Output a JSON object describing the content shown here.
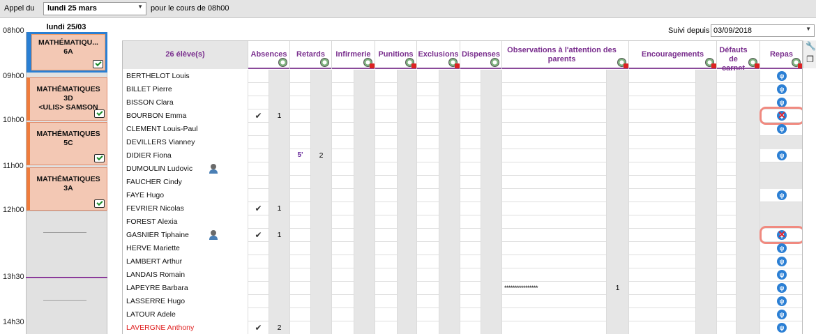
{
  "topbar": {
    "appel_label": "Appel du",
    "date_value": "lundi 25 mars",
    "course_label": "pour le cours de 08h00"
  },
  "timeline": {
    "day_label": "lundi 25/03",
    "hours": [
      "08h00",
      "09h00",
      "10h00",
      "11h00",
      "12h00",
      "13h30",
      "14h30"
    ],
    "courses": [
      {
        "title": "MATHÉMATIQU...",
        "group": "6A",
        "selected": true
      },
      {
        "title": "MATHÉMATIQUES",
        "group": "3D",
        "extra": "<ULIS> SAMSON"
      },
      {
        "title": "MATHÉMATIQUES",
        "group": "5C"
      },
      {
        "title": "MATHÉMATIQUES",
        "group": "3A"
      }
    ]
  },
  "suivi": {
    "label": "Suivi depuis",
    "value": "03/09/2018"
  },
  "grid": {
    "headers": {
      "students": "26 élève(s)",
      "absences": "Absences",
      "retards": "Retards",
      "infirmerie": "Infirmerie",
      "punitions": "Punitions",
      "exclusions": "Exclusions",
      "dispenses": "Dispenses",
      "observations": "Observations à l'attention des parents",
      "encouragements": "Encouragements",
      "defauts": "Défauts de carnet",
      "repas": "Repas"
    },
    "rows": [
      {
        "name": "BERTHELOT Louis",
        "meal": "yes"
      },
      {
        "name": "BILLET Pierre",
        "meal": "yes"
      },
      {
        "name": "BISSON Clara",
        "meal": "yes"
      },
      {
        "name": "BOURBON Emma",
        "absent": "✔",
        "abs_count": "1",
        "meal": "no"
      },
      {
        "name": "CLEMENT Louis-Paul",
        "meal": "yes"
      },
      {
        "name": "DEVILLERS Vianney",
        "meal": ""
      },
      {
        "name": "DIDIER Fiona",
        "late": "5'",
        "late_count": "2",
        "meal": "yes"
      },
      {
        "name": "DUMOULIN Ludovic",
        "person": true,
        "meal": ""
      },
      {
        "name": "FAUCHER Cindy",
        "meal": ""
      },
      {
        "name": "FAYE Hugo",
        "meal": "yes"
      },
      {
        "name": "FEVRIER Nicolas",
        "absent": "✔",
        "abs_count": "1",
        "meal": ""
      },
      {
        "name": "FOREST Alexia",
        "meal": ""
      },
      {
        "name": "GASNIER Tiphaine",
        "person": true,
        "absent": "✔",
        "abs_count": "1",
        "meal": "no"
      },
      {
        "name": "HERVE Mariette",
        "meal": "yes"
      },
      {
        "name": "LAMBERT Arthur",
        "meal": "yes"
      },
      {
        "name": "LANDAIS Romain",
        "meal": "yes"
      },
      {
        "name": "LAPEYRE Barbara",
        "obs": "****************",
        "obs_count": "1",
        "meal": "yes"
      },
      {
        "name": "LASSERRE Hugo",
        "meal": "yes"
      },
      {
        "name": "LATOUR Adele",
        "meal": "yes"
      },
      {
        "name": "LAVERGNE Anthony",
        "red": true,
        "absent": "✔",
        "abs_count": "2",
        "meal": "yes"
      }
    ]
  },
  "meal_glyph": "ψ",
  "colors": {
    "header_text": "#7a2f8e",
    "accent_blue": "#2a7fd3",
    "course_bg": "#f3c8b4",
    "course_border": "#ef7c3d",
    "highlight_ring": "#f08a80"
  }
}
